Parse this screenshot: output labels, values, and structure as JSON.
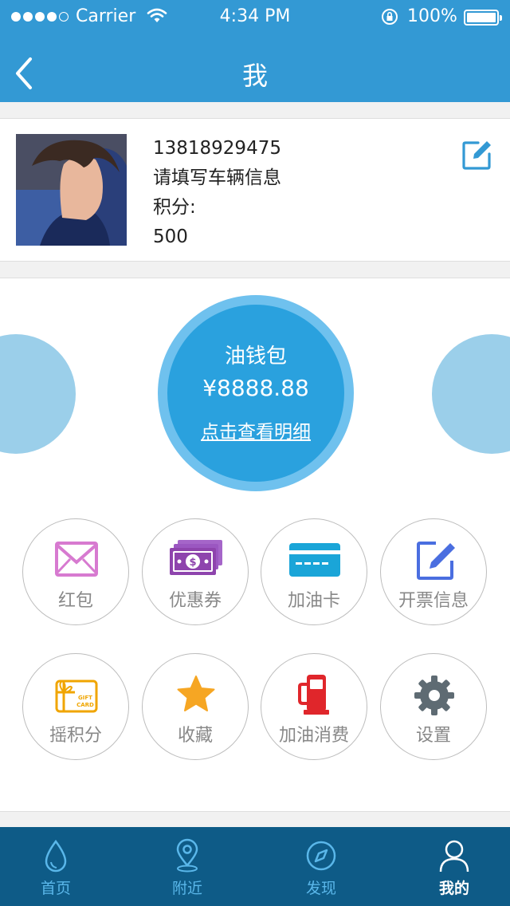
{
  "status_bar": {
    "carrier": "Carrier",
    "time": "4:34 PM",
    "battery": "100%"
  },
  "nav": {
    "title": "我"
  },
  "profile": {
    "phone": "13818929475",
    "vehicle_prompt": "请填写车辆信息",
    "points_label": "积分:",
    "points_value": "500"
  },
  "wallet": {
    "title": "油钱包",
    "amount": "¥8888.88",
    "details_link": "点击查看明细"
  },
  "grid": [
    {
      "label": "红包",
      "icon": "envelope-icon",
      "color": "#d77ad0"
    },
    {
      "label": "优惠券",
      "icon": "cash-icon",
      "color": "#8e44ad"
    },
    {
      "label": "加油卡",
      "icon": "card-icon",
      "color": "#1aa5d8"
    },
    {
      "label": "开票信息",
      "icon": "edit-icon",
      "color": "#4a6ee0"
    },
    {
      "label": "摇积分",
      "icon": "gift-card-icon",
      "color": "#f0a500"
    },
    {
      "label": "收藏",
      "icon": "star-icon",
      "color": "#f6a623"
    },
    {
      "label": "加油消费",
      "icon": "fuel-pump-icon",
      "color": "#e0262b"
    },
    {
      "label": "设置",
      "icon": "gear-icon",
      "color": "#5e6b73"
    }
  ],
  "tabs": [
    {
      "label": "首页",
      "icon": "drop-icon"
    },
    {
      "label": "附近",
      "icon": "location-pin-icon"
    },
    {
      "label": "发现",
      "icon": "compass-icon"
    },
    {
      "label": "我的",
      "icon": "person-icon",
      "active": true
    }
  ],
  "colors": {
    "primary": "#3399d4",
    "tabbar": "#0e5b87",
    "wallet": "#2aa1de",
    "wallet_ring": "#6fc1ee",
    "side_circle": "#9bcfea"
  }
}
